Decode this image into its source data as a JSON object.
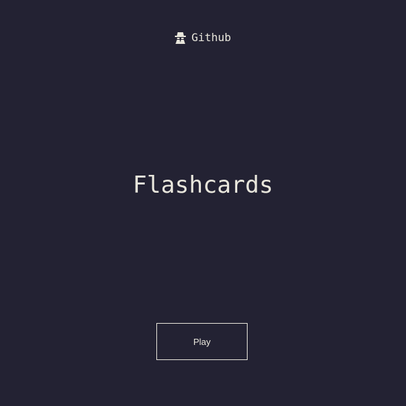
{
  "header": {
    "github_label": "Github",
    "icon": "spy-icon"
  },
  "main": {
    "title": "Flashcards",
    "play_label": "Play"
  },
  "colors": {
    "background": "#232233",
    "text": "#e8e6dc"
  }
}
